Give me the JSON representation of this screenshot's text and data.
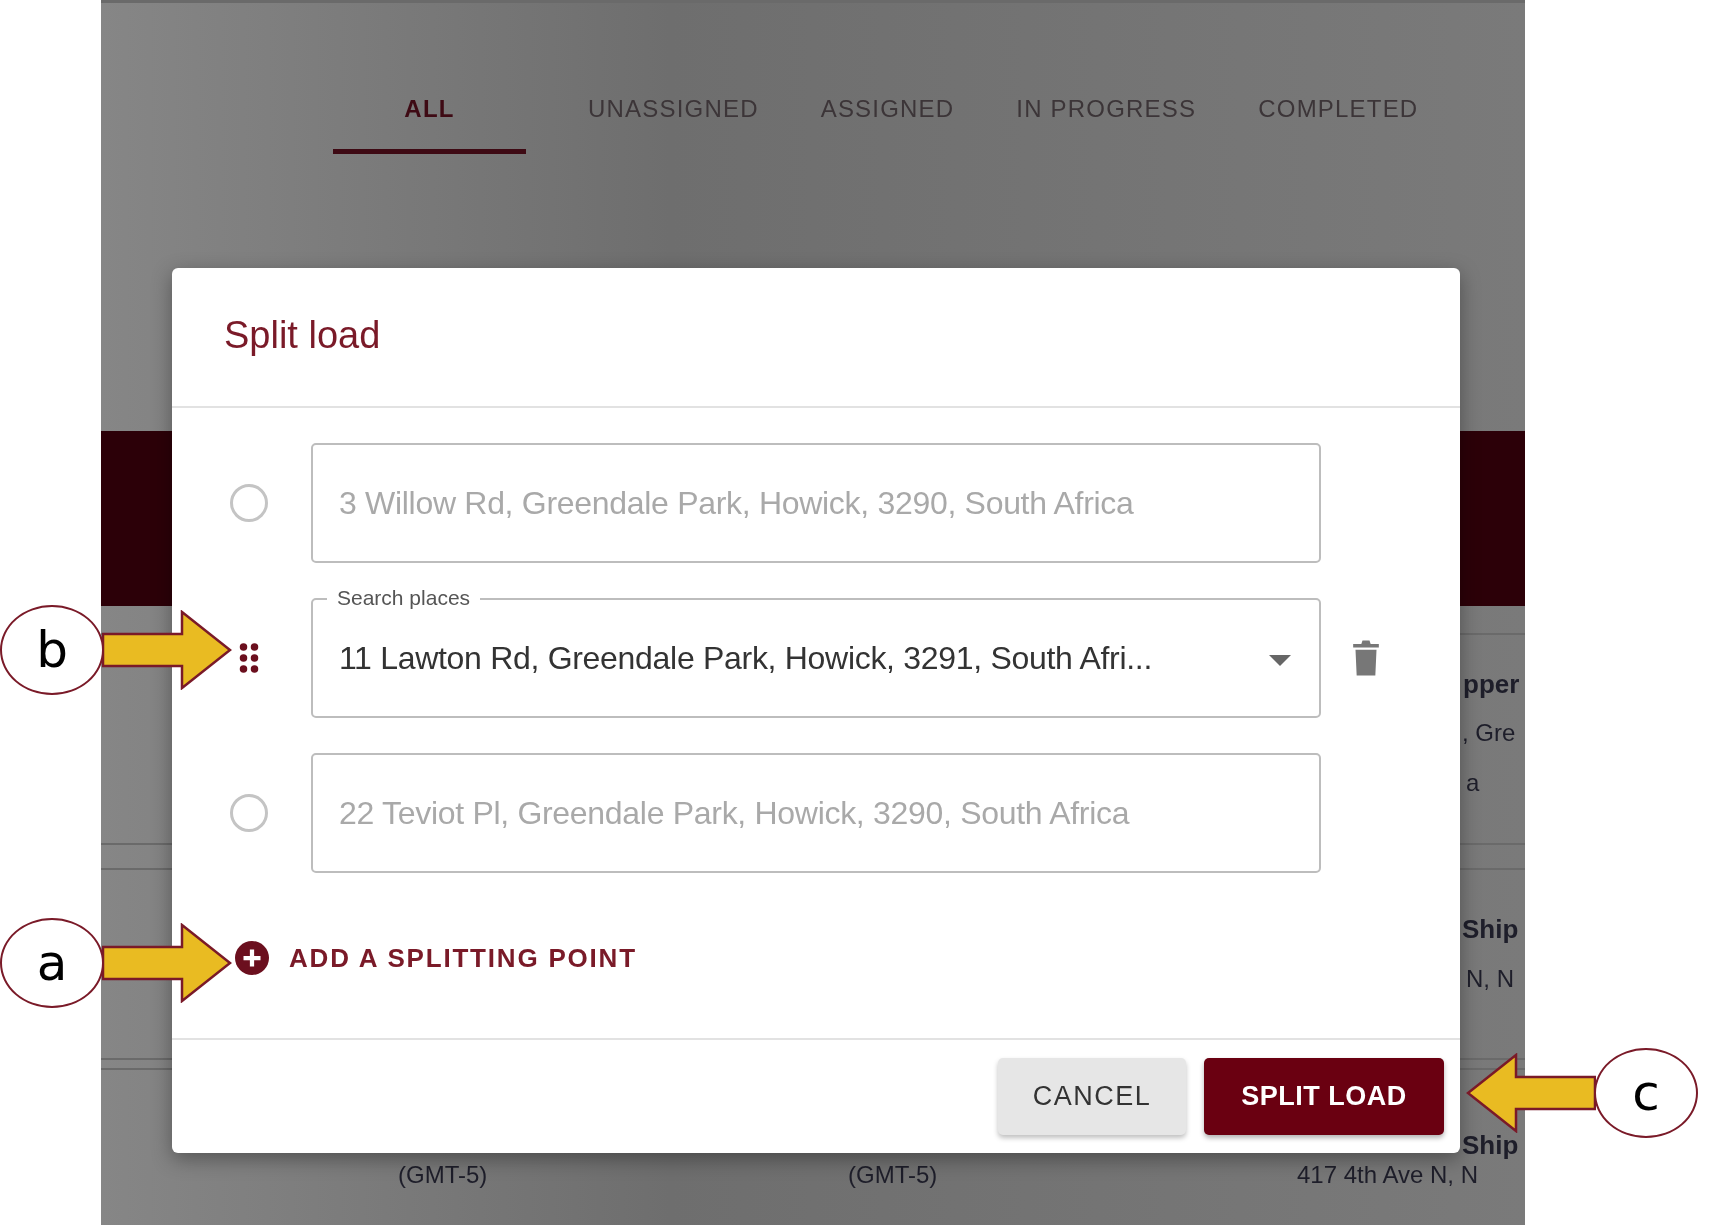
{
  "tabs": [
    {
      "label": "ALL",
      "selected": true
    },
    {
      "label": "UNASSIGNED",
      "selected": false
    },
    {
      "label": "ASSIGNED",
      "selected": false
    },
    {
      "label": "IN PROGRESS",
      "selected": false
    },
    {
      "label": "COMPLETED",
      "selected": false
    }
  ],
  "background_texts": [
    "pper",
    ", Gre",
    "a",
    "Ship",
    "N, N",
    "Ship",
    "(GMT-5)",
    "(GMT-5)",
    "417 4th Ave N, N"
  ],
  "dialog": {
    "title": "Split load",
    "stops": [
      {
        "kind": "fixed",
        "value": "3 Willow Rd, Greendale Park, Howick, 3290, South Africa",
        "disabled": true,
        "selected": false
      },
      {
        "kind": "split",
        "label": "Search places",
        "value": "11 Lawton Rd, Greendale Park, Howick, 3291, South Afri...",
        "disabled": false
      },
      {
        "kind": "fixed",
        "value": "22 Teviot Pl, Greendale Park, Howick, 3290, South Africa",
        "disabled": true,
        "selected": false
      }
    ],
    "add_link": "ADD A SPLITTING POINT",
    "buttons": [
      {
        "kind": "secondary",
        "label": "CANCEL"
      },
      {
        "kind": "primary",
        "label": "SPLIT LOAD"
      }
    ]
  },
  "callouts": [
    {
      "letter": "b"
    },
    {
      "letter": "a"
    },
    {
      "letter": "c"
    }
  ]
}
